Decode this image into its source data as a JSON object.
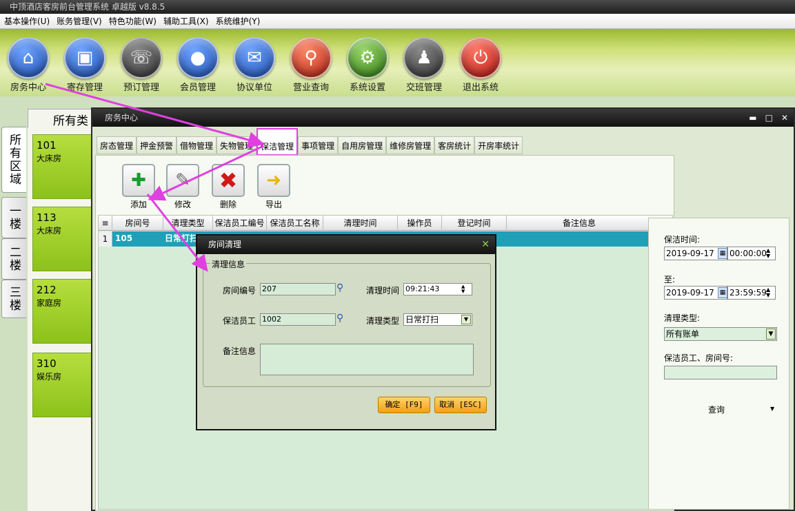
{
  "app": {
    "title": "中顶酒店客房前台管理系统 卓越版 v8.8.5"
  },
  "menu": [
    "基本操作(U)",
    "账务管理(V)",
    "特色功能(W)",
    "辅助工具(X)",
    "系统维护(Y)"
  ],
  "toolbar": [
    {
      "label": "房务中心",
      "icon": "house-icon",
      "color": "#2a64c8"
    },
    {
      "label": "寄存管理",
      "icon": "bag-icon",
      "color": "#2a64c8"
    },
    {
      "label": "预订管理",
      "icon": "phone-icon",
      "color": "#4a4a4a"
    },
    {
      "label": "会员管理",
      "icon": "person-icon",
      "color": "#2a64c8"
    },
    {
      "label": "协议单位",
      "icon": "document-badge-icon",
      "color": "#2a64c8"
    },
    {
      "label": "营业查询",
      "icon": "magnifier-icon",
      "color": "#d23a1e"
    },
    {
      "label": "系统设置",
      "icon": "gear-icon",
      "color": "#4f9a1e"
    },
    {
      "label": "交班管理",
      "icon": "people-meeting-icon",
      "color": "#4a4a4a"
    },
    {
      "label": "退出系统",
      "icon": "power-icon",
      "color": "#d2281e"
    }
  ],
  "side_tabs": [
    "所有区域",
    "一楼",
    "二楼",
    "三楼"
  ],
  "rooms_header": "所有类",
  "rooms": [
    {
      "number": "101",
      "type": "大床房"
    },
    {
      "number": "113",
      "type": "大床房"
    },
    {
      "number": "212",
      "type": "家庭房"
    },
    {
      "number": "310",
      "type": "娱乐房"
    }
  ],
  "window": {
    "title": "房务中心",
    "tabs": [
      "房态管理",
      "押金预警",
      "借物管理",
      "失物管理",
      "保洁管理",
      "事项管理",
      "自用房管理",
      "维修房管理",
      "客房统计",
      "开房率统计"
    ],
    "active_tab": "保洁管理",
    "actions": [
      {
        "label": "添加",
        "icon": "add-document-icon"
      },
      {
        "label": "修改",
        "icon": "edit-document-icon"
      },
      {
        "label": "删除",
        "icon": "delete-x-icon"
      },
      {
        "label": "导出",
        "icon": "export-document-icon"
      }
    ]
  },
  "table": {
    "columns": [
      "房间号",
      "清理类型",
      "保洁员工编号",
      "保洁员工名称",
      "清理时间",
      "操作员",
      "登记时间",
      "备注信息"
    ],
    "rows": [
      {
        "index": "1",
        "room": "105",
        "type": "日常打扫"
      }
    ]
  },
  "filter": {
    "time_label": "保洁时间:",
    "from_date": "2019-09-17",
    "from_time": "00:00:00",
    "to_label": "至:",
    "to_date": "2019-09-17",
    "to_time": "23:59:59",
    "type_label": "清理类型:",
    "type_value": "所有账单",
    "staff_label": "保洁员工、房间号:",
    "staff_value": "",
    "query_button": "查询"
  },
  "dialog": {
    "title": "房间清理",
    "group": "清理信息",
    "room_label": "房间编号",
    "room_value": "207",
    "time_label": "清理时间",
    "time_value": "09:21:43",
    "staff_label": "保洁员工",
    "staff_value": "1002",
    "type_label": "清理类型",
    "type_value": "日常打扫",
    "note_label": "备注信息",
    "note_value": "",
    "ok_button": "确定 [F9]",
    "cancel_button": "取消 [ESC]"
  },
  "colors": {
    "accent": "#e040e0",
    "selected_row": "#1fa0b8",
    "room_tile": "#9ccc2a"
  }
}
